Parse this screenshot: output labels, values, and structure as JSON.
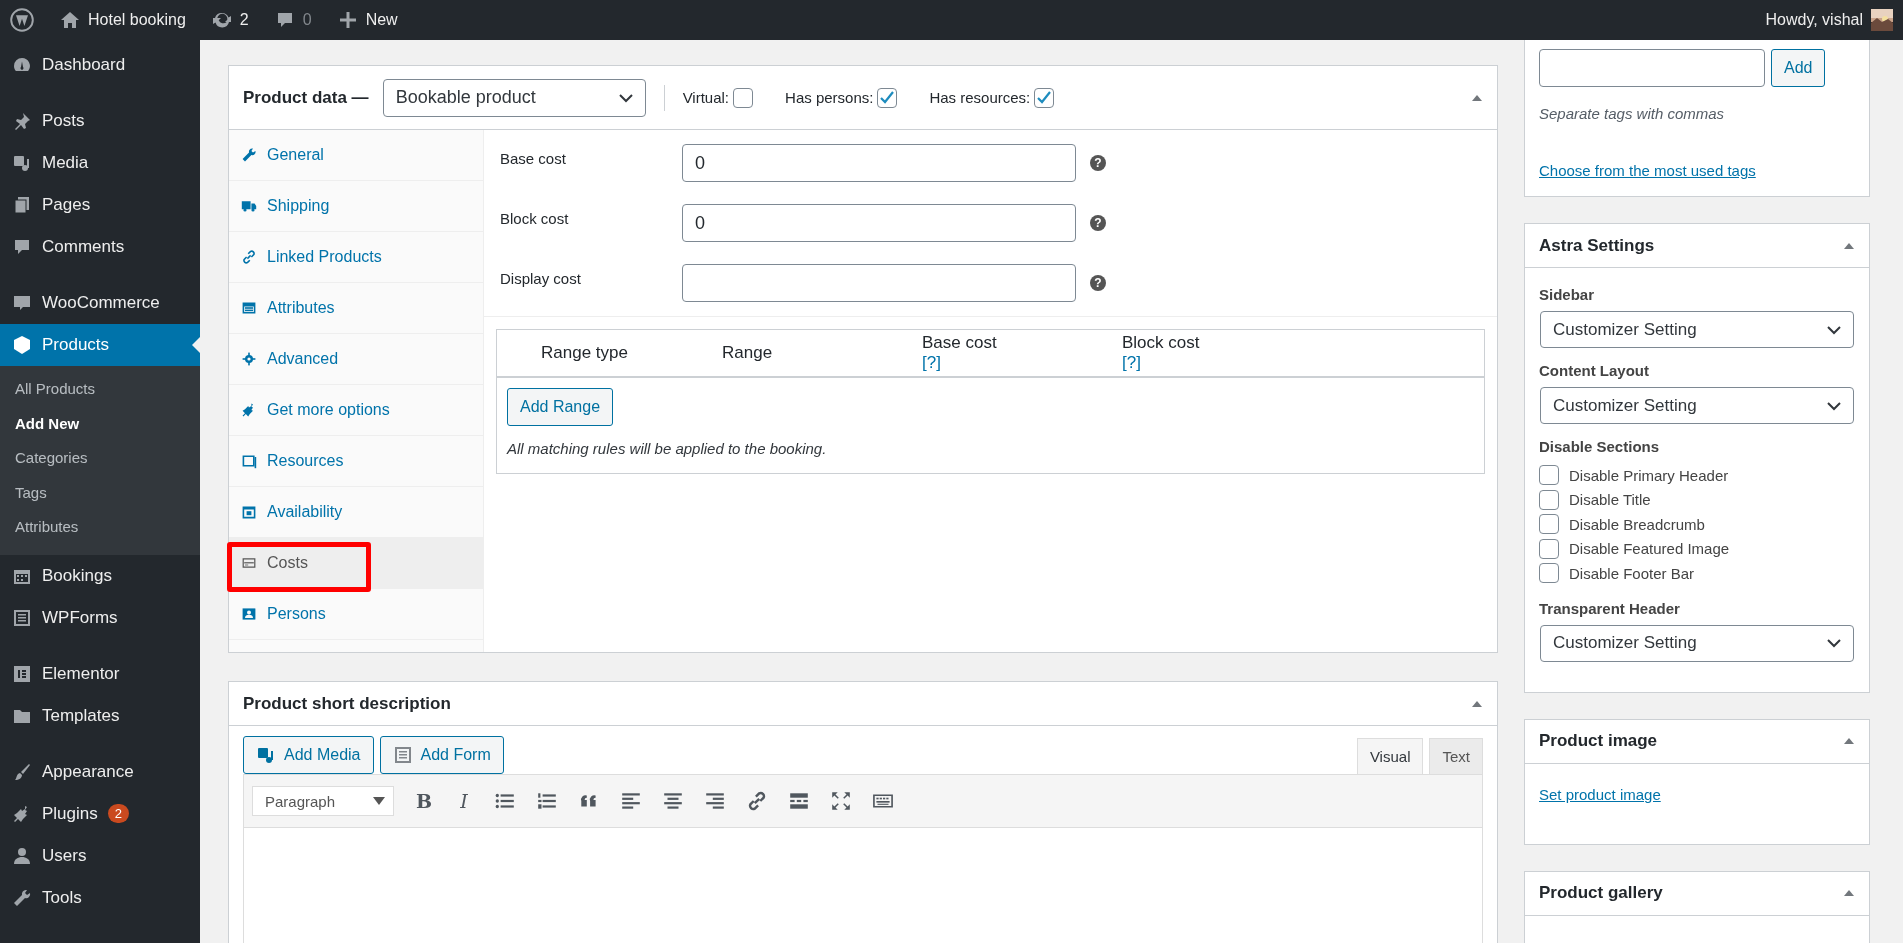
{
  "admin_bar": {
    "site": "Hotel booking",
    "updates": "2",
    "comments": "0",
    "new": "New",
    "greeting": "Howdy, vishal"
  },
  "menu_groups": [
    {
      "items": [
        {
          "label": "Dashboard",
          "selected": false
        }
      ]
    },
    {
      "items": [
        {
          "label": "Posts",
          "selected": false
        },
        {
          "label": "Media",
          "selected": false
        },
        {
          "label": "Pages",
          "selected": false
        },
        {
          "label": "Comments",
          "selected": false
        }
      ]
    },
    {
      "items": [
        {
          "label": "WooCommerce",
          "selected": false
        },
        {
          "label": "Products",
          "selected": true,
          "children": [
            {
              "label": "All Products",
              "selected": false
            },
            {
              "label": "Add New",
              "selected": true
            },
            {
              "label": "Categories",
              "selected": false
            },
            {
              "label": "Tags",
              "selected": false
            },
            {
              "label": "Attributes",
              "selected": false
            }
          ]
        },
        {
          "label": "Bookings",
          "selected": false
        },
        {
          "label": "WPForms",
          "selected": false
        }
      ]
    },
    {
      "items": [
        {
          "label": "Elementor",
          "selected": false
        },
        {
          "label": "Templates",
          "selected": false
        }
      ]
    },
    {
      "items": [
        {
          "label": "Appearance",
          "selected": false
        },
        {
          "label": "Plugins",
          "selected": false,
          "badge": "2"
        },
        {
          "label": "Users",
          "selected": false
        },
        {
          "label": "Tools",
          "selected": false
        }
      ]
    }
  ],
  "product_data": {
    "title": "Product data —",
    "type": "Bookable product",
    "options": [
      {
        "label": "Virtual:",
        "checked": false
      },
      {
        "label": "Has persons:",
        "checked": true
      },
      {
        "label": "Has resources:",
        "checked": true
      }
    ],
    "tabs": [
      {
        "label": "General",
        "selected": false,
        "highlighted": false
      },
      {
        "label": "Shipping",
        "selected": false,
        "highlighted": false
      },
      {
        "label": "Linked Products",
        "selected": false,
        "highlighted": false
      },
      {
        "label": "Attributes",
        "selected": false,
        "highlighted": false
      },
      {
        "label": "Advanced",
        "selected": false,
        "highlighted": false
      },
      {
        "label": "Get more options",
        "selected": false,
        "highlighted": false
      },
      {
        "label": "Resources",
        "selected": false,
        "highlighted": false
      },
      {
        "label": "Availability",
        "selected": false,
        "highlighted": false
      },
      {
        "label": "Costs",
        "selected": true,
        "highlighted": true
      },
      {
        "label": "Persons",
        "selected": false,
        "highlighted": false
      }
    ],
    "fields": [
      {
        "label": "Base cost",
        "value": "0",
        "help": "?"
      },
      {
        "label": "Block cost",
        "value": "0",
        "help": "?"
      },
      {
        "label": "Display cost",
        "help": "?"
      }
    ],
    "range_table": {
      "columns": [
        {
          "label": "Range type"
        },
        {
          "label": "Range"
        },
        {
          "label": "Base cost",
          "help": "[?]"
        },
        {
          "label": "Block cost",
          "help": "[?]"
        }
      ],
      "add_button": "Add Range",
      "note": "All matching rules will be applied to the booking."
    }
  },
  "short_description": {
    "title": "Product short description",
    "buttons": [
      "Add Media",
      "Add Form"
    ],
    "editor_tabs": [
      {
        "label": "Visual",
        "selected": true
      },
      {
        "label": "Text",
        "selected": false
      }
    ],
    "format": "Paragraph",
    "bold": "B",
    "italic": "I"
  },
  "tags_box": {
    "add": "Add",
    "hint": "Separate tags with commas",
    "link": "Choose from the most used tags"
  },
  "astra": {
    "title": "Astra Settings",
    "sections": [
      {
        "kind": "select",
        "label": "Sidebar",
        "value": "Customizer Setting"
      },
      {
        "kind": "select",
        "label": "Content Layout",
        "value": "Customizer Setting"
      },
      {
        "kind": "checks",
        "label": "Disable Sections",
        "items": [
          {
            "label": "Disable Primary Header",
            "checked": false
          },
          {
            "label": "Disable Title",
            "checked": false
          },
          {
            "label": "Disable Breadcrumb",
            "checked": false
          },
          {
            "label": "Disable Featured Image",
            "checked": false
          },
          {
            "label": "Disable Footer Bar",
            "checked": false
          }
        ]
      },
      {
        "kind": "select",
        "label": "Transparent Header",
        "value": "Customizer Setting"
      }
    ]
  },
  "product_image": {
    "title": "Product image",
    "link": "Set product image"
  },
  "product_gallery": {
    "title": "Product gallery"
  }
}
